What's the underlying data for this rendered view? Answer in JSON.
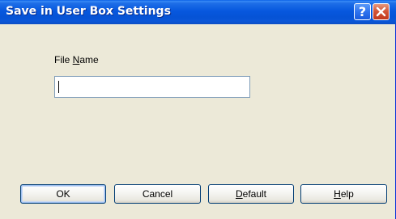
{
  "window": {
    "title": "Save in User Box Settings"
  },
  "title_buttons": {
    "help_glyph": "?",
    "close_icon": "close-icon"
  },
  "form": {
    "file_name_label_prefix": "File ",
    "file_name_label_accel": "N",
    "file_name_label_suffix": "ame",
    "file_name_value": ""
  },
  "buttons": {
    "ok": "OK",
    "cancel": "Cancel",
    "default_accel": "D",
    "default_rest": "efault",
    "help_accel": "H",
    "help_rest": "elp"
  },
  "colors": {
    "titlebar": "#0758DE",
    "dialog_bg": "#ECE9D8",
    "close_button": "#D4573A",
    "button_border": "#003C74"
  }
}
